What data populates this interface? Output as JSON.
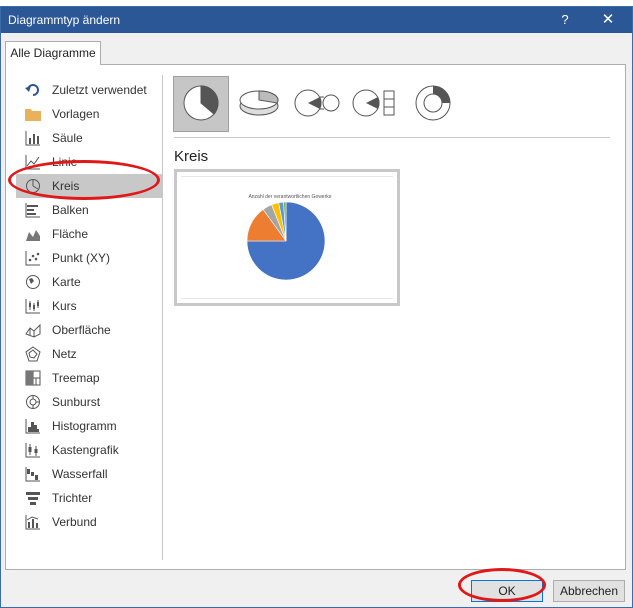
{
  "dialog": {
    "title": "Diagrammtyp ändern",
    "help_glyph": "?",
    "close_glyph": "✕",
    "tab_label": "Alle Diagramme"
  },
  "chart_types": [
    {
      "label": "Zuletzt verwendet",
      "icon": "undo-icon"
    },
    {
      "label": "Vorlagen",
      "icon": "folder-icon"
    },
    {
      "label": "Säule",
      "icon": "column-chart-icon"
    },
    {
      "label": "Linie",
      "icon": "line-chart-icon"
    },
    {
      "label": "Kreis",
      "icon": "pie-chart-icon",
      "selected": true
    },
    {
      "label": "Balken",
      "icon": "bar-chart-icon"
    },
    {
      "label": "Fläche",
      "icon": "area-chart-icon"
    },
    {
      "label": "Punkt (XY)",
      "icon": "scatter-chart-icon"
    },
    {
      "label": "Karte",
      "icon": "map-chart-icon"
    },
    {
      "label": "Kurs",
      "icon": "stock-chart-icon"
    },
    {
      "label": "Oberfläche",
      "icon": "surface-chart-icon"
    },
    {
      "label": "Netz",
      "icon": "radar-chart-icon"
    },
    {
      "label": "Treemap",
      "icon": "treemap-icon"
    },
    {
      "label": "Sunburst",
      "icon": "sunburst-icon"
    },
    {
      "label": "Histogramm",
      "icon": "histogram-icon"
    },
    {
      "label": "Kastengrafik",
      "icon": "box-whisker-icon"
    },
    {
      "label": "Wasserfall",
      "icon": "waterfall-icon"
    },
    {
      "label": "Trichter",
      "icon": "funnel-icon"
    },
    {
      "label": "Verbund",
      "icon": "combo-chart-icon"
    }
  ],
  "subtypes": [
    {
      "icon": "pie-subtype-icon",
      "selected": true
    },
    {
      "icon": "pie-3d-subtype-icon"
    },
    {
      "icon": "pie-of-pie-subtype-icon"
    },
    {
      "icon": "bar-of-pie-subtype-icon"
    },
    {
      "icon": "doughnut-subtype-icon"
    }
  ],
  "section_title": "Kreis",
  "chart_data": {
    "type": "pie",
    "title": "Anzahl der verantwortlichen Gewerke",
    "values": [
      75,
      15,
      4,
      3,
      2,
      1
    ],
    "colors": [
      "#4472c4",
      "#ed7d31",
      "#a5a5a5",
      "#ffc000",
      "#5b9bd5",
      "#70ad47"
    ]
  },
  "buttons": {
    "ok": "OK",
    "cancel": "Abbrechen"
  },
  "colors": {
    "titlebar": "#2b5797",
    "annotation_ring": "#e01818",
    "selection": "#c8c8c8"
  }
}
